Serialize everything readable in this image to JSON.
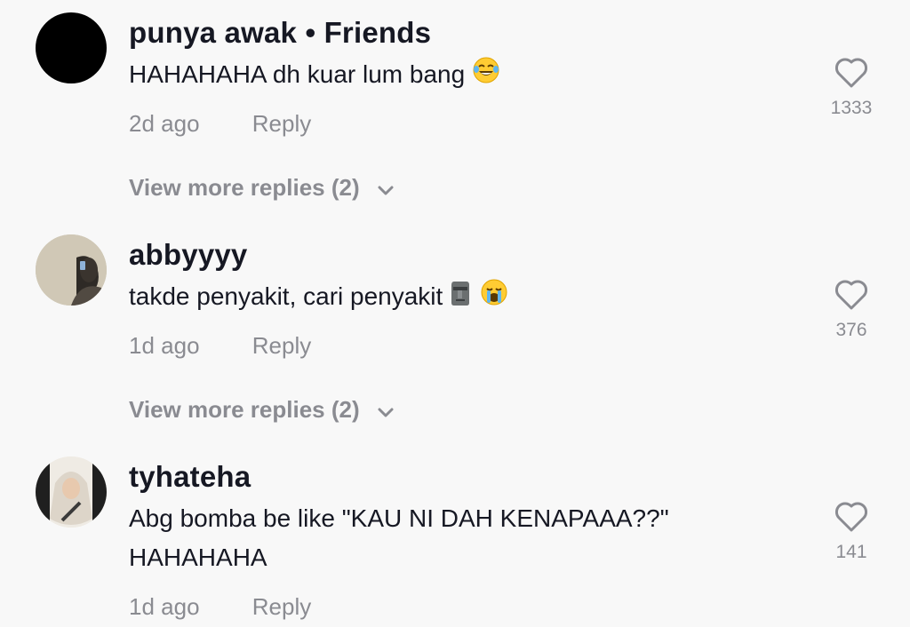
{
  "comments": [
    {
      "username": "punya awak • Friends",
      "text": "HAHAHAHA dh kuar lum bang",
      "emojis": [
        "face-with-tears-of-joy"
      ],
      "time": "2d ago",
      "reply_label": "Reply",
      "likes": "1333",
      "view_more": "View more replies (2)",
      "avatar": "black-circle"
    },
    {
      "username": "abbyyyy",
      "text": "takde penyakit, cari penyakit",
      "emojis": [
        "moai",
        "loudly-crying-face"
      ],
      "time": "1d ago",
      "reply_label": "Reply",
      "likes": "376",
      "view_more": "View more replies (2)",
      "avatar": "photo-person-mirror"
    },
    {
      "username": "tyhateha",
      "text_lines": [
        "Abg bomba be like \"KAU NI DAH KENAPAAA??\"",
        "HAHAHAHA"
      ],
      "time": "1d ago",
      "reply_label": "Reply",
      "likes": "141",
      "avatar": "photo-person-hijab"
    }
  ],
  "colors": {
    "background": "#f8f8f8",
    "primary_text": "#161823",
    "secondary_text": "#8a8b91"
  },
  "icons": {
    "like": "heart-outline-icon",
    "expand": "chevron-down-icon"
  }
}
